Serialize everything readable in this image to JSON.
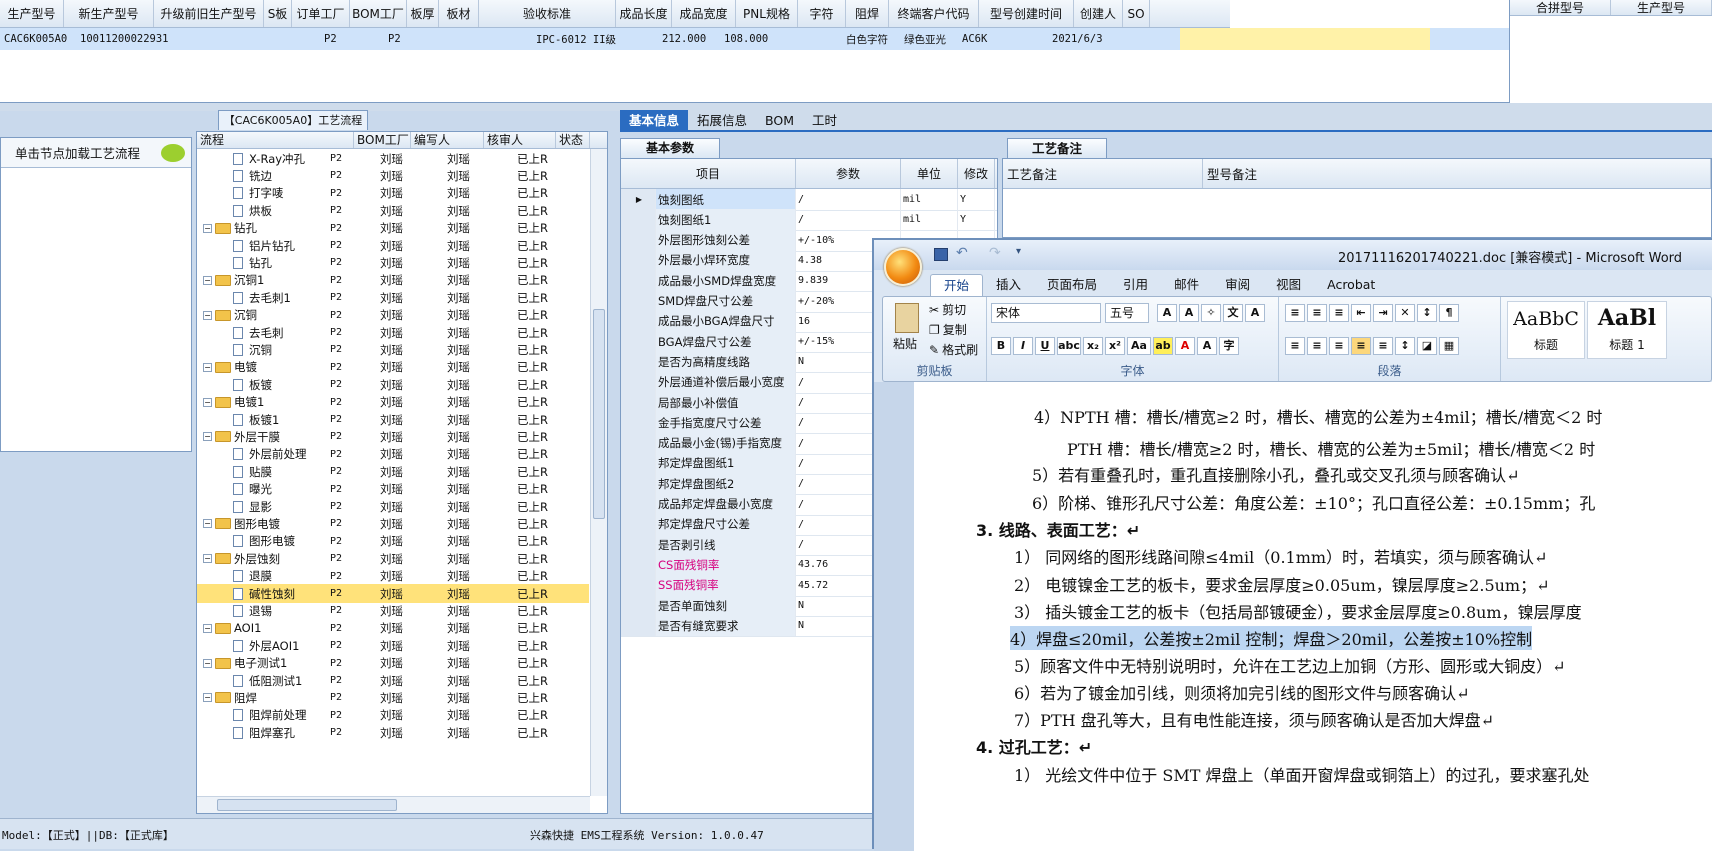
{
  "top_grid": {
    "headers": [
      "生产型号",
      "新生产型号",
      "升级前旧生产型号",
      "S板",
      "订单工厂",
      "BOM工厂",
      "板厚",
      "板材",
      "验收标准",
      "成品长度",
      "成品宽度",
      "PNL规格",
      "字符",
      "阻焊",
      "终端客户代码",
      "型号创建时间",
      "创建人",
      "SO"
    ],
    "row": {
      "model": "CAC6K005A0",
      "new_model": "10011200022931",
      "order_factory": "P2",
      "bom_factory": "P2",
      "standard": "IPC-6012 II级",
      "length": "212.000",
      "width": "108.000",
      "char": "白色字符",
      "solder": "绿色亚光",
      "customer": "AC6K",
      "created": "2021/6/3"
    }
  },
  "right_grid": {
    "headers": [
      "合拼型号",
      "生产型号"
    ]
  },
  "left_panel": {
    "hint": "单击节点加载工艺流程"
  },
  "tree": {
    "title": "【CAC6K005A0】工艺流程",
    "headers": [
      "流程",
      "BOM工厂",
      "编写人",
      "核审人",
      "状态"
    ],
    "rows": [
      {
        "level": 2,
        "name": "X-Ray冲孔",
        "folder": false
      },
      {
        "level": 2,
        "name": "铣边",
        "folder": false
      },
      {
        "level": 2,
        "name": "打字唛",
        "folder": false
      },
      {
        "level": 2,
        "name": "烘板",
        "folder": false
      },
      {
        "level": 1,
        "name": "钻孔",
        "folder": true
      },
      {
        "level": 2,
        "name": "铝片钻孔",
        "folder": false
      },
      {
        "level": 2,
        "name": "钻孔",
        "folder": false
      },
      {
        "level": 1,
        "name": "沉铜1",
        "folder": true
      },
      {
        "level": 2,
        "name": "去毛刺1",
        "folder": false
      },
      {
        "level": 1,
        "name": "沉铜",
        "folder": true
      },
      {
        "level": 2,
        "name": "去毛刺",
        "folder": false
      },
      {
        "level": 2,
        "name": "沉铜",
        "folder": false
      },
      {
        "level": 1,
        "name": "电镀",
        "folder": true
      },
      {
        "level": 2,
        "name": "板镀",
        "folder": false
      },
      {
        "level": 1,
        "name": "电镀1",
        "folder": true
      },
      {
        "level": 2,
        "name": "板镀1",
        "folder": false
      },
      {
        "level": 1,
        "name": "外层干膜",
        "folder": true
      },
      {
        "level": 2,
        "name": "外层前处理",
        "folder": false
      },
      {
        "level": 2,
        "name": "贴膜",
        "folder": false
      },
      {
        "level": 2,
        "name": "曝光",
        "folder": false
      },
      {
        "level": 2,
        "name": "显影",
        "folder": false
      },
      {
        "level": 1,
        "name": "图形电镀",
        "folder": true
      },
      {
        "level": 2,
        "name": "图形电镀",
        "folder": false
      },
      {
        "level": 1,
        "name": "外层蚀刻",
        "folder": true
      },
      {
        "level": 2,
        "name": "退膜",
        "folder": false
      },
      {
        "level": 2,
        "name": "碱性蚀刻",
        "folder": false,
        "selected": true
      },
      {
        "level": 2,
        "name": "退锡",
        "folder": false
      },
      {
        "level": 1,
        "name": "AOI1",
        "folder": true
      },
      {
        "level": 2,
        "name": "外层AOI1",
        "folder": false
      },
      {
        "level": 1,
        "name": "电子测试1",
        "folder": true
      },
      {
        "level": 2,
        "name": "低阻测试1",
        "folder": false
      },
      {
        "level": 1,
        "name": "阻焊",
        "folder": true
      },
      {
        "level": 2,
        "name": "阻焊前处理",
        "folder": false
      },
      {
        "level": 2,
        "name": "阻焊塞孔",
        "folder": false
      }
    ],
    "bom": "P2",
    "writer": "刘瑶",
    "checker": "刘瑶",
    "status": "已上R"
  },
  "mid_tabs": [
    "基本信息",
    "拓展信息",
    "BOM",
    "工时"
  ],
  "basic_tab": "基本参数",
  "params": {
    "headers": [
      "项目",
      "参数",
      "单位",
      "修改"
    ],
    "rows": [
      {
        "name": "蚀刻图纸",
        "value": "/",
        "unit": "mil",
        "flag": "Y",
        "selected": true
      },
      {
        "name": "蚀刻图纸1",
        "value": "/",
        "unit": "mil",
        "flag": "Y"
      },
      {
        "name": "外层图形蚀刻公差",
        "value": "+/-10%",
        "unit": "",
        "flag": ""
      },
      {
        "name": "外层最小焊环宽度",
        "value": "4.38",
        "unit": "",
        "flag": ""
      },
      {
        "name": "成品最小SMD焊盘宽度",
        "value": "9.839",
        "unit": "",
        "flag": ""
      },
      {
        "name": "SMD焊盘尺寸公差",
        "value": "+/-20%",
        "unit": "",
        "flag": ""
      },
      {
        "name": "成品最小BGA焊盘尺寸",
        "value": "16",
        "unit": "",
        "flag": ""
      },
      {
        "name": "BGA焊盘尺寸公差",
        "value": "+/-15%",
        "unit": "",
        "flag": ""
      },
      {
        "name": "是否为高精度线路",
        "value": "N",
        "unit": "",
        "flag": ""
      },
      {
        "name": "外层通道补偿后最小宽度",
        "value": "/",
        "unit": "",
        "flag": ""
      },
      {
        "name": "局部最小补偿值",
        "value": "/",
        "unit": "",
        "flag": ""
      },
      {
        "name": "金手指宽度尺寸公差",
        "value": "/",
        "unit": "",
        "flag": ""
      },
      {
        "name": "成品最小金(锡)手指宽度",
        "value": "/",
        "unit": "",
        "flag": ""
      },
      {
        "name": "邦定焊盘图纸1",
        "value": "/",
        "unit": "",
        "flag": ""
      },
      {
        "name": "邦定焊盘图纸2",
        "value": "/",
        "unit": "",
        "flag": ""
      },
      {
        "name": "成品邦定焊盘最小宽度",
        "value": "/",
        "unit": "",
        "flag": ""
      },
      {
        "name": "邦定焊盘尺寸公差",
        "value": "/",
        "unit": "",
        "flag": ""
      },
      {
        "name": "是否剥引线",
        "value": "/",
        "unit": "",
        "flag": ""
      },
      {
        "name": "CS面残铜率",
        "value": "43.76",
        "unit": "",
        "flag": "",
        "pink": true
      },
      {
        "name": "SS面残铜率",
        "value": "45.72",
        "unit": "",
        "flag": "",
        "pink": true
      },
      {
        "name": "是否单面蚀刻",
        "value": "N",
        "unit": "",
        "flag": ""
      },
      {
        "name": "是否有缝宽要求",
        "value": "N",
        "unit": "",
        "flag": ""
      }
    ]
  },
  "notes": {
    "tab": "工艺备注",
    "headers": [
      "工艺备注",
      "型号备注"
    ]
  },
  "status": {
    "model": "Model:【正式】||DB:【正式库】",
    "system": "兴森快捷 EMS工程系统 Version: 1.0.0.47"
  },
  "word": {
    "title": "20171116201740221.doc [兼容模式] - Microsoft Word",
    "tabs": [
      "开始",
      "插入",
      "页面布局",
      "引用",
      "邮件",
      "审阅",
      "视图",
      "Acrobat"
    ],
    "paste": "粘贴",
    "cut": "剪切",
    "copy": "复制",
    "format_painter": "格式刷",
    "clipboard": "剪贴板",
    "font_name": "宋体",
    "font_size": "五号",
    "font_group": "字体",
    "para_group": "段落",
    "style1_sample": "AaBbC",
    "style1_label": "标题",
    "style2_sample": "AaBl",
    "style2_label": "标题 1",
    "lines": [
      "4）NPTH 槽：槽长/槽宽≥2 时，槽长、槽宽的公差为±4mil；槽长/槽宽＜2 时",
      "PTH 槽：槽长/槽宽≥2 时，槽长、槽宽的公差为±5mil；槽长/槽宽＜2 时",
      "5）若有重叠孔时，重孔直接删除小孔，叠孔或交叉孔须与顾客确认↵",
      "6）阶梯、锥形孔尺寸公差：角度公差：±10°；孔口直径公差：±0.15mm；孔",
      "3.   线路、表面工艺：↵",
      "1） 同网络的图形线路间隙≤4mil（0.1mm）时，若填实，须与顾客确认↵",
      "2） 电镀镍金工艺的板卡，要求金层厚度≥0.05um，镍层厚度≥2.5um；↵",
      "3） 插头镀金工艺的板卡（包括局部镀硬金），要求金层厚度≥0.8um，镍层厚度",
      "4）焊盘≤20mil，公差按±2mil 控制；焊盘＞20mil，公差按±10%控制",
      "5）顾客文件中无特别说明时，允许在工艺边上加铜（方形、圆形或大铜皮）↵",
      "6）若为了镀金加引线，则须将加完引线的图形文件与顾客确认↵",
      "7）PTH 盘孔等大，且有电性能连接，须与顾客确认是否加大焊盘↵",
      "4.   过孔工艺：↵",
      "1） 光绘文件中位于 SMT 焊盘上（单面开窗焊盘或铜箔上）的过孔，要求塞孔处"
    ]
  }
}
